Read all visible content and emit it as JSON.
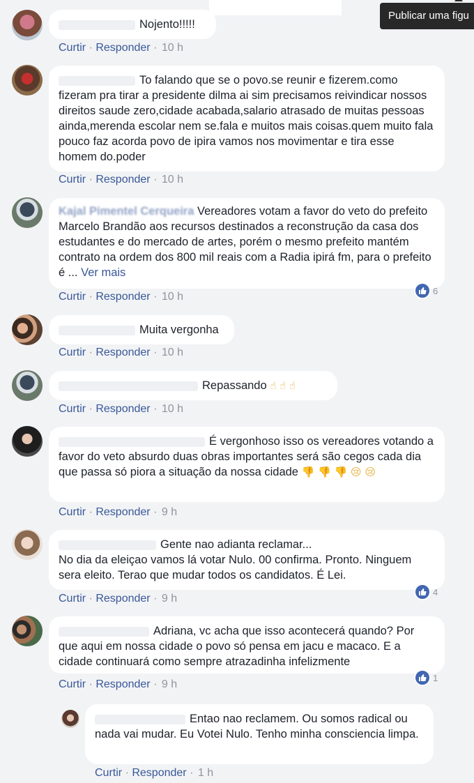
{
  "tooltip": {
    "text": "Publicar uma figu"
  },
  "actions": {
    "like": "Curtir",
    "reply": "Responder",
    "sep": "·"
  },
  "comments": [
    {
      "text": "Nojento!!!!!",
      "time": "10 h"
    },
    {
      "text": "To falando que se o povo.se reunir e fizerem.como fizeram pra tirar a presidente dilma ai sim precisamos reivindicar nossos direitos saude zero,cidade acabada,salario atrasado de muitas pessoas ainda,merenda escolar nem se.fala e muitos mais coisas.quem muito fala pouco faz acorda povo de ipira vamos nos movimentar e tira esse homem do.poder",
      "time": "10 h"
    },
    {
      "name_partial": "Kajal Pimentel Cerqueira",
      "text": "Vereadores votam a favor do veto do prefeito Marcelo Brandão aos recursos destinados a reconstrução da casa dos estudantes e do mercado de artes, porém o mesmo prefeito mantém contrato na ordem dos 800 mil reais com a Radia ipirá fm, para o prefeito é ...",
      "see_more": "Ver mais",
      "time": "10 h",
      "reactions": "6"
    },
    {
      "text": "Muita vergonha",
      "time": "10 h"
    },
    {
      "text": "Repassando",
      "emoji": "☝ ☝ ☝",
      "time": "10 h"
    },
    {
      "text": "É vergonhoso isso os vereadores votando a favor do veto absurdo duas obras importantes será são cegos cada dia que passa só piora a situação da nossa cidade",
      "emoji": "👎 👎 👎 😢 😢",
      "time": "9 h"
    },
    {
      "text_line1": "Gente nao adianta reclamar...",
      "text_rest": "No dia da eleiçao vamos lá votar Nulo. 00 confirma. Pronto. Ninguem sera eleito. Terao que mudar todos os candidatos. É Lei.",
      "time": "9 h",
      "reactions": "4"
    },
    {
      "text": "Adriana, vc acha que isso acontecerá quando? Por que aqui em nossa cidade o povo só pensa em jacu e macaco. E a cidade continuará como sempre atrazadinha infelizmente",
      "time": "9 h",
      "reactions": "1"
    },
    {
      "text": "Entao nao reclamem. Ou somos radical ou nada vai mudar. Eu Votei Nulo. Tenho minha consciencia limpa.",
      "time": "1 h"
    }
  ]
}
